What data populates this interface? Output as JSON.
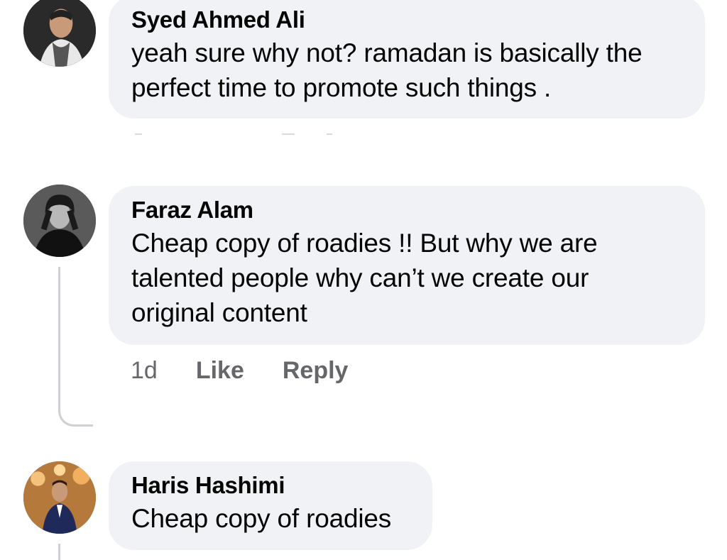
{
  "comments": [
    {
      "author": "Syed Ahmed Ali",
      "text": "yeah sure why not? ramadan is basically the\nperfect time to promote such things ."
    },
    {
      "author": "Faraz Alam",
      "text": "Cheap copy of roadies !! But why we are\ntalented people why can’t we create our\noriginal content",
      "time": "1d",
      "like_label": "Like",
      "reply_label": "Reply"
    },
    {
      "author": "Haris Hashimi",
      "text": "Cheap copy of roadies"
    }
  ],
  "colors": {
    "bubble": "#f0f2f5",
    "text": "#050505",
    "meta": "#65676b",
    "thread": "#ced0d4"
  }
}
